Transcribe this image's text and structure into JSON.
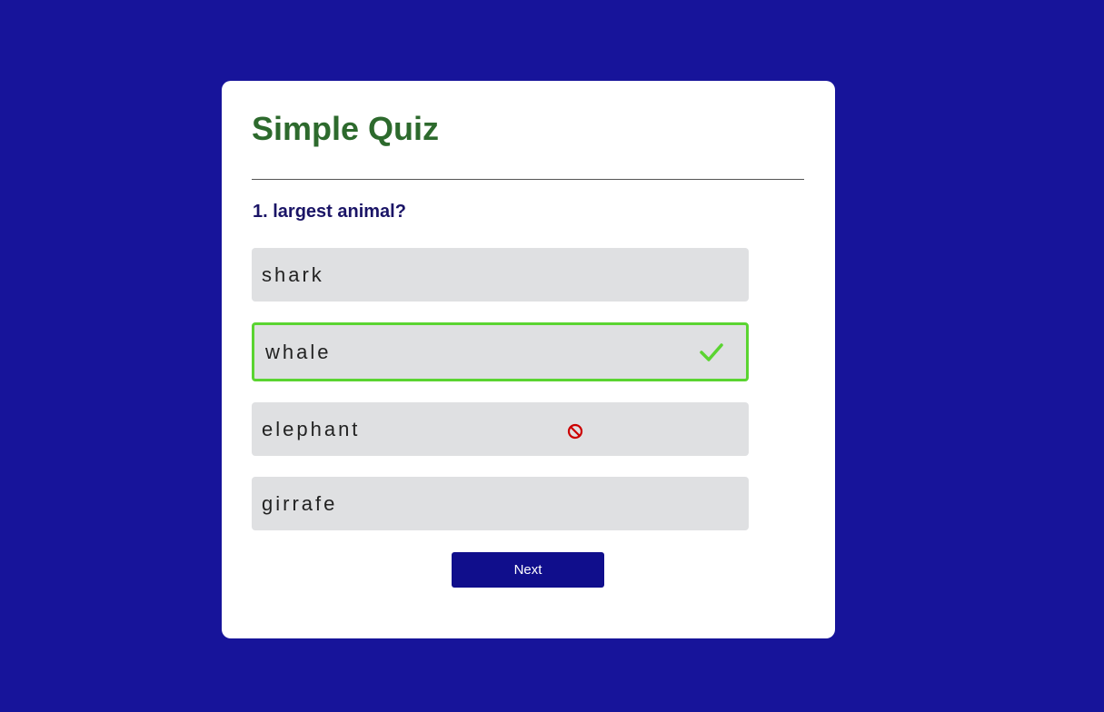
{
  "quiz": {
    "title": "Simple Quiz",
    "question": "1. largest animal?",
    "answers": [
      {
        "label": "shark",
        "state": "neutral"
      },
      {
        "label": "whale",
        "state": "correct",
        "icon": "check-icon"
      },
      {
        "label": "elephant",
        "state": "incorrect",
        "icon": "block-icon"
      },
      {
        "label": "girrafe",
        "state": "neutral"
      }
    ],
    "next_label": "Next"
  },
  "colors": {
    "background": "#17149a",
    "title": "#2d6a2d",
    "question": "#1a1466",
    "correct_border": "#5ad431",
    "incorrect_icon": "#cc0000",
    "button": "#100e8c"
  }
}
